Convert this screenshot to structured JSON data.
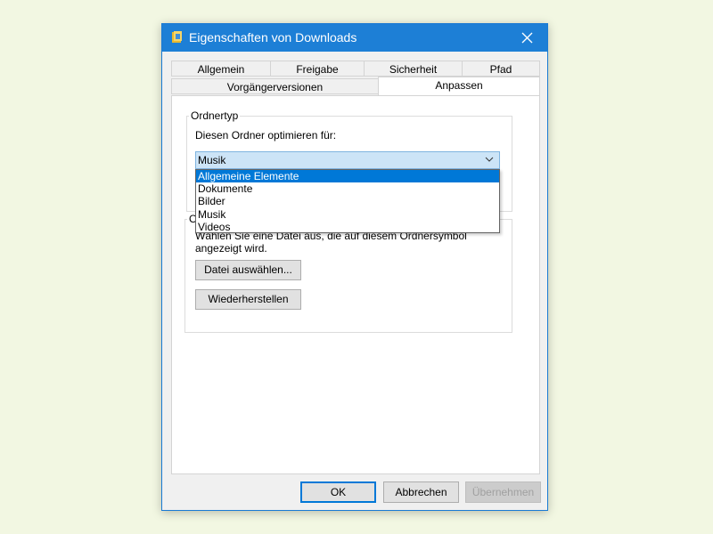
{
  "window": {
    "title": "Eigenschaften von Downloads",
    "close_icon": "close-icon",
    "accent_color": "#1d7fd6"
  },
  "tabs": {
    "row1": [
      "Allgemein",
      "Freigabe",
      "Sicherheit",
      "Pfad"
    ],
    "row2": [
      "Vorgängerversionen",
      "Anpassen"
    ],
    "active": "Anpassen"
  },
  "folder_type": {
    "group_title": "Ordnertyp",
    "optimize_label": "Diesen Ordner optimieren für:",
    "selected_value": "Musik",
    "options": [
      "Allgemeine Elemente",
      "Dokumente",
      "Bilder",
      "Musik",
      "Videos"
    ],
    "highlighted_option": "Allgemeine Elemente"
  },
  "folder_icon": {
    "group_title_visible": "O",
    "description_partial": "Wählen Sie eine Datei aus, die auf diesem Ordnersymbol",
    "description_line2": "angezeigt wird.",
    "choose_file_button": "Datei auswählen...",
    "restore_button": "Wiederherstellen"
  },
  "footer": {
    "ok": "OK",
    "cancel": "Abbrechen",
    "apply": "Übernehmen",
    "apply_disabled": true
  }
}
